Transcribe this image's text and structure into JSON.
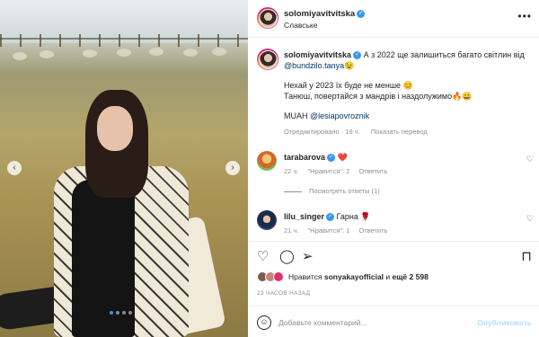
{
  "post": {
    "author": "solomiyavitvitska",
    "location": "Славське",
    "more_icon": "•••",
    "photo_alt": "",
    "carousel": {
      "count": 4,
      "active": 0
    }
  },
  "caption": {
    "author": "solomiyavitvitska",
    "text_1": "А з 2022 ще залишиться багато світлин від",
    "mention_1": "@bundzilo.tanya",
    "emoji_1": "😉",
    "line_2": "Нехай у 2023 їх буде не менше",
    "emoji_2": "😊",
    "line_3": "Танюш, повертайся з мандрів і наздолужимо",
    "emoji_3": "🔥😀",
    "muah": "MUAH",
    "mention_2": "@lesiapovroznik",
    "edited": "Отредактировано · 19 ч.",
    "translate": "Показать перевод"
  },
  "comments": [
    {
      "user": "tarabarova",
      "text": "❤️",
      "time": "22 ч.",
      "likes": "\"Нравится\": 2",
      "reply": "Ответить",
      "view_replies": "Посмотреть ответы (1)"
    },
    {
      "user": "lilu_singer",
      "text": "Гарна 🌹",
      "time": "21 ч.",
      "likes": "\"Нравится\": 1",
      "reply": "Ответить"
    }
  ],
  "likes": {
    "prefix": "Нравится",
    "user": "sonyakayofficial",
    "suffix_connector": "и",
    "others": "ещё 2 598"
  },
  "timestamp": "23 ЧАСОВ НАЗАД",
  "add_comment": {
    "placeholder": "Добавьте комментарий...",
    "publish": "Опубликовать"
  },
  "colors": {
    "verified": "#3897f0",
    "mention": "#00376b",
    "muted": "#8e8e8e",
    "publish_disabled": "#b2dffc"
  }
}
